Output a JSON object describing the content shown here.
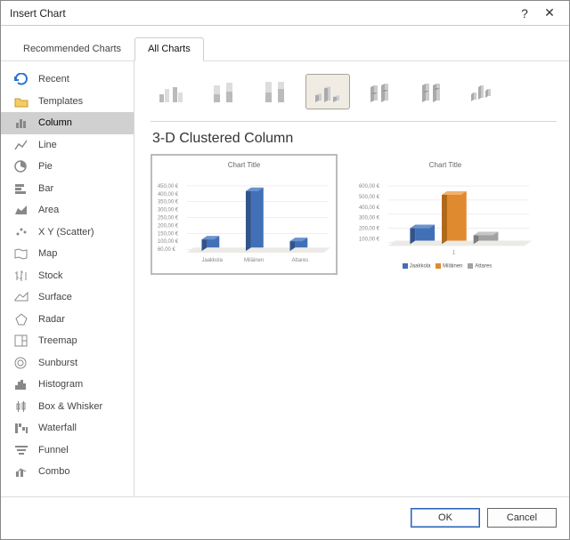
{
  "dialog": {
    "title": "Insert Chart",
    "help": "?",
    "close": "✕"
  },
  "tabs": {
    "recommended": "Recommended Charts",
    "all": "All Charts"
  },
  "sidebar": {
    "items": [
      {
        "label": "Recent"
      },
      {
        "label": "Templates"
      },
      {
        "label": "Column"
      },
      {
        "label": "Line"
      },
      {
        "label": "Pie"
      },
      {
        "label": "Bar"
      },
      {
        "label": "Area"
      },
      {
        "label": "X Y (Scatter)"
      },
      {
        "label": "Map"
      },
      {
        "label": "Stock"
      },
      {
        "label": "Surface"
      },
      {
        "label": "Radar"
      },
      {
        "label": "Treemap"
      },
      {
        "label": "Sunburst"
      },
      {
        "label": "Histogram"
      },
      {
        "label": "Box & Whisker"
      },
      {
        "label": "Waterfall"
      },
      {
        "label": "Funnel"
      },
      {
        "label": "Combo"
      }
    ],
    "selected_index": 2
  },
  "subtype_title": "3-D Clustered Column",
  "subtypes": [
    {
      "name": "clustered-column"
    },
    {
      "name": "stacked-column"
    },
    {
      "name": "100-stacked-column"
    },
    {
      "name": "3d-clustered-column"
    },
    {
      "name": "3d-stacked-column"
    },
    {
      "name": "3d-100-stacked"
    },
    {
      "name": "3d-column"
    }
  ],
  "selected_subtype_index": 3,
  "previews": {
    "selected_index": 0,
    "p1": {
      "title": "Chart Title",
      "categories": [
        "Jaakkola",
        "Miläinen",
        "Attares"
      ],
      "yticks": [
        "60,00 €",
        "100,00 €",
        "150,00 €",
        "200,00 €",
        "250,00 €",
        "300,00 €",
        "350,00 €",
        "400,00 €",
        "450,00 €"
      ]
    },
    "p2": {
      "title": "Chart Title",
      "legend": [
        "Jaakkola",
        "Miläinen",
        "Attares"
      ],
      "xcat": "1",
      "yticks": [
        "100,00 €",
        "200,00 €",
        "300,00 €",
        "400,00 €",
        "500,00 €",
        "600,00 €"
      ]
    }
  },
  "colors": {
    "blue": "#4170b7",
    "orange": "#e08a2f",
    "grey": "#a2a2a2"
  },
  "buttons": {
    "ok": "OK",
    "cancel": "Cancel"
  },
  "chart_data": [
    {
      "type": "bar",
      "orientation": "3d",
      "title": "Chart Title",
      "categories": [
        "Jaakkola",
        "Miläinen",
        "Attares"
      ],
      "values": [
        100,
        430,
        90
      ],
      "ylabel": "€",
      "ylim": [
        0,
        450
      ],
      "grid": true
    },
    {
      "type": "bar",
      "orientation": "3d",
      "title": "Chart Title",
      "categories": [
        "1"
      ],
      "series": [
        {
          "name": "Jaakkola",
          "values": [
            200
          ],
          "color": "#4170b7"
        },
        {
          "name": "Miläinen",
          "values": [
            560
          ],
          "color": "#e08a2f"
        },
        {
          "name": "Attares",
          "values": [
            110
          ],
          "color": "#a2a2a2"
        }
      ],
      "ylabel": "€",
      "ylim": [
        0,
        600
      ],
      "grid": true,
      "legend_position": "bottom"
    }
  ]
}
